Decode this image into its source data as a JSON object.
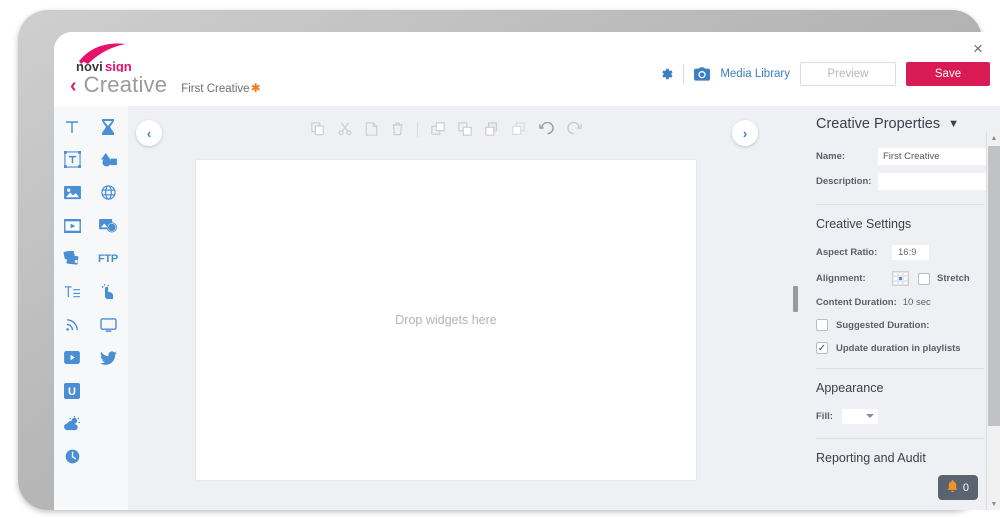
{
  "app": {
    "logo_text": "novisign",
    "close_label": "×"
  },
  "header": {
    "back_chevron": "‹",
    "page_title": "Creative",
    "document_name": "First Creative",
    "dirty_marker": "✱",
    "gear_icon": "gear-icon",
    "camera_icon": "camera-icon",
    "media_library_label": "Media Library",
    "preview_label": "Preview",
    "save_label": "Save",
    "save_color": "#d81b54"
  },
  "widget_toolbar": {
    "items": [
      {
        "icon": "text-icon",
        "label": "Text"
      },
      {
        "icon": "hourglass-icon",
        "label": "Countdown"
      },
      {
        "icon": "rich-text-icon",
        "label": "Rich Text"
      },
      {
        "icon": "shapes-icon",
        "label": "Shapes"
      },
      {
        "icon": "image-icon",
        "label": "Image"
      },
      {
        "icon": "globe-icon",
        "label": "Web Page"
      },
      {
        "icon": "video-icon",
        "label": "Video"
      },
      {
        "icon": "web-image-icon",
        "label": "Web Image"
      },
      {
        "icon": "slideshow-icon",
        "label": "Slideshow"
      },
      {
        "icon": "ftp-icon",
        "label": "FTP"
      },
      {
        "icon": "text-list-icon",
        "label": "Text List"
      },
      {
        "icon": "touch-icon",
        "label": "Touch"
      },
      {
        "icon": "rss-icon",
        "label": "RSS"
      },
      {
        "icon": "screen-icon",
        "label": "Screen"
      },
      {
        "icon": "youtube-icon",
        "label": "YouTube"
      },
      {
        "icon": "twitter-icon",
        "label": "Twitter"
      },
      {
        "icon": "u-icon",
        "label": "U"
      },
      {
        "icon": "weather-icon",
        "label": "Weather"
      },
      {
        "icon": "clock-icon",
        "label": "Clock"
      }
    ],
    "collapse_left": "‹",
    "collapse_right": "›"
  },
  "edit_toolbar": {
    "buttons": [
      {
        "icon": "copy-icon",
        "label": "Copy"
      },
      {
        "icon": "cut-icon",
        "label": "Cut"
      },
      {
        "icon": "paste-icon",
        "label": "Paste"
      },
      {
        "icon": "trash-icon",
        "label": "Delete"
      },
      {
        "icon": "bring-to-front-icon",
        "label": "Bring to front"
      },
      {
        "icon": "bring-forward-icon",
        "label": "Bring forward"
      },
      {
        "icon": "send-backward-icon",
        "label": "Send backward"
      },
      {
        "icon": "send-to-back-icon",
        "label": "Send to back"
      },
      {
        "icon": "undo-icon",
        "label": "Undo"
      },
      {
        "icon": "redo-icon",
        "label": "Redo"
      }
    ]
  },
  "canvas": {
    "placeholder": "Drop widgets here"
  },
  "properties": {
    "panel_title": "Creative Properties",
    "panel_chevron": "▼",
    "name_label": "Name:",
    "name_value": "First Creative",
    "description_label": "Description:",
    "description_value": "",
    "settings_title": "Creative Settings",
    "aspect_ratio_label": "Aspect Ratio:",
    "aspect_ratio_value": "16:9",
    "alignment_label": "Alignment:",
    "stretch_label": "Stretch",
    "stretch_checked": false,
    "content_duration_label": "Content Duration:",
    "content_duration_value": "10 sec",
    "suggested_duration_label": "Suggested Duration:",
    "suggested_duration_checked": false,
    "update_duration_label": "Update duration in playlists",
    "update_duration_checked": true,
    "update_duration_mark": "✓",
    "appearance_title": "Appearance",
    "fill_label": "Fill:",
    "fill_value": "",
    "reporting_title": "Reporting and Audit"
  },
  "notification": {
    "bell_icon": "bell-icon",
    "count": "0",
    "color": "#f0932b"
  }
}
